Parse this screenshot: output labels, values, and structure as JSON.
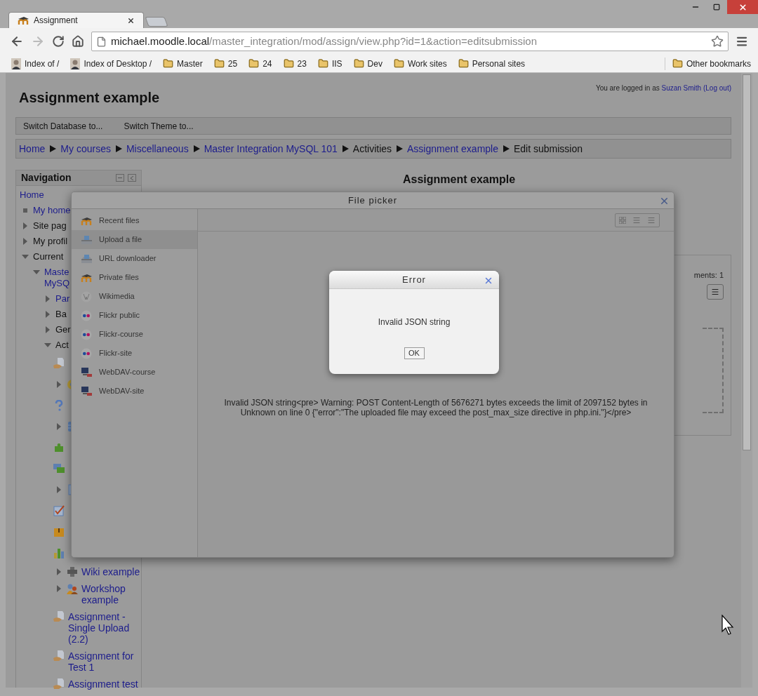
{
  "browser": {
    "tabs": [
      {
        "title": "Assignment",
        "selected": true
      }
    ],
    "url": {
      "host": "michael.moodle.local",
      "path": "/master_integration/mod/assign/view.php?id=1&action=editsubmission"
    },
    "bookmarks": [
      {
        "label": "Index of /",
        "kind": "person"
      },
      {
        "label": "Index of Desktop /",
        "kind": "person"
      },
      {
        "label": "Master",
        "kind": "folder"
      },
      {
        "label": "25",
        "kind": "folder"
      },
      {
        "label": "24",
        "kind": "folder"
      },
      {
        "label": "23",
        "kind": "folder"
      },
      {
        "label": "IIS",
        "kind": "folder"
      },
      {
        "label": "Dev",
        "kind": "folder"
      },
      {
        "label": "Work sites",
        "kind": "folder"
      },
      {
        "label": "Personal sites",
        "kind": "folder"
      }
    ],
    "other_bookmarks": "Other bookmarks"
  },
  "page": {
    "title": "Assignment example",
    "login": {
      "prefix": "You are logged in as",
      "user": "Suzan Smith",
      "logout": "(Log out)"
    },
    "menu": [
      "Switch Database to...",
      "Switch Theme to..."
    ],
    "breadcrumb": [
      {
        "label": "Home",
        "link": true
      },
      {
        "label": "My courses",
        "link": true
      },
      {
        "label": "Miscellaneous",
        "link": true
      },
      {
        "label": "Master Integration MySQL 101",
        "link": true
      },
      {
        "label": "Activities",
        "link": false
      },
      {
        "label": "Assignment example",
        "link": true
      },
      {
        "label": "Edit submission",
        "link": false
      }
    ],
    "navigation": {
      "title": "Navigation",
      "items": [
        {
          "label": "Home",
          "link": true
        },
        {
          "label": "My home",
          "link": true,
          "bullet": true
        },
        {
          "label": "Site pag",
          "link": false,
          "expanded": false
        },
        {
          "label": "My profil",
          "link": false,
          "expanded": false
        },
        {
          "label": "Current",
          "link": false,
          "expanded": true,
          "children": [
            {
              "label": "Maste\nMySQ",
              "link": true,
              "expanded": true,
              "children": [
                {
                  "label": "Par",
                  "link": true,
                  "expanded": false
                },
                {
                  "label": "Ba",
                  "link": false,
                  "expanded": false
                },
                {
                  "label": "Ger",
                  "link": false,
                  "expanded": false
                },
                {
                  "label": "Act",
                  "link": false,
                  "expanded": true,
                  "children": [
                    {
                      "kind": "assignment"
                    },
                    {
                      "kind": "chat",
                      "expanded": false
                    },
                    {
                      "kind": "question"
                    },
                    {
                      "kind": "database",
                      "expanded": false
                    },
                    {
                      "kind": "puzzle"
                    },
                    {
                      "kind": "forum"
                    },
                    {
                      "kind": "page",
                      "expanded": false
                    },
                    {
                      "kind": "choice"
                    },
                    {
                      "kind": "box"
                    },
                    {
                      "kind": "chart"
                    },
                    {
                      "kind": "wiki",
                      "label": "Wiki example",
                      "link": true,
                      "expanded": false
                    },
                    {
                      "kind": "workshop",
                      "label": "Workshop example",
                      "link": true,
                      "expanded": false
                    },
                    {
                      "kind": "assignment",
                      "label": "Assignment - Single Upload (2.2)",
                      "link": true
                    },
                    {
                      "kind": "assignment",
                      "label": "Assignment for Test 1",
                      "link": true
                    },
                    {
                      "kind": "assignment",
                      "label": "Assignment test",
                      "link": true
                    }
                  ]
                }
              ]
            }
          ]
        }
      ]
    },
    "heading": "Assignment example",
    "side_fragment": "ments: 1"
  },
  "file_picker": {
    "title": "File picker",
    "repositories": [
      {
        "label": "Recent files",
        "kind": "moodle",
        "selected": false
      },
      {
        "label": "Upload a file",
        "kind": "upload",
        "selected": true
      },
      {
        "label": "URL downloader",
        "kind": "upload",
        "selected": false
      },
      {
        "label": "Private files",
        "kind": "moodle",
        "selected": false
      },
      {
        "label": "Wikimedia",
        "kind": "globe",
        "selected": false
      },
      {
        "label": "Flickr public",
        "kind": "flickr",
        "selected": false
      },
      {
        "label": "Flickr-course",
        "kind": "flickr",
        "selected": false
      },
      {
        "label": "Flickr-site",
        "kind": "flickr",
        "selected": false
      },
      {
        "label": "WebDAV-course",
        "kind": "monitor",
        "selected": false
      },
      {
        "label": "WebDAV-site",
        "kind": "monitor",
        "selected": false
      }
    ],
    "message": "Invalid JSON string<pre> Warning: POST Content-Length of 5676271 bytes exceeds the limit of 2097152 bytes in Unknown on line 0 {\"error\":\"The uploaded file may exceed the post_max_size directive in php.ini.\"}</pre>"
  },
  "error_dialog": {
    "title": "Error",
    "message": "Invalid JSON string",
    "button": "OK"
  }
}
